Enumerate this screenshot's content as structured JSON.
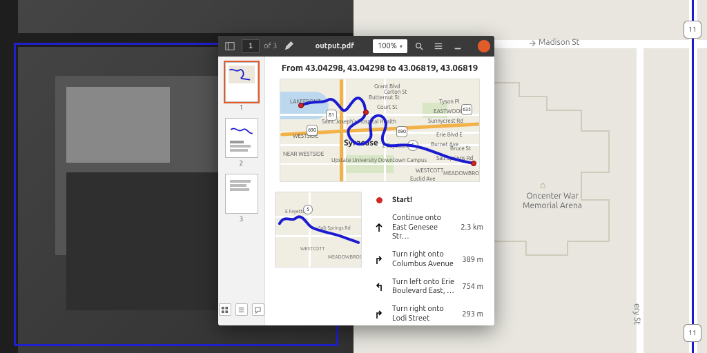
{
  "background": {
    "right_map": {
      "street_label": "Madison St",
      "arena_label": "Oncenter War Memorial Arena",
      "shield_1": "11",
      "shield_2": "11",
      "side_street": "ery St"
    }
  },
  "pdf": {
    "toolbar": {
      "page_input": "1",
      "of_text": "of 3",
      "title": "output.pdf",
      "zoom": "100%"
    },
    "thumbs": {
      "labels": [
        "1",
        "2",
        "3"
      ],
      "selected_index": 0
    },
    "doc_title": "From 43.04298, 43.04298 to 43.06819, 43.06819",
    "map_wide": {
      "city_label": "Syracuse",
      "labels": {
        "lakefront": "LAKEFRONT",
        "near_westside": "NEAR WESTSIDE",
        "westside": "WESTSIDE",
        "eastwood": "EASTWOOD",
        "westcott": "WESTCOTT",
        "meadowbrook": "MEADOWBROOK",
        "hospital": "Saint Joseph's Hospital Health",
        "upstate": "Upstate University Downtown Campus",
        "grant": "Grant Blvd",
        "butternut": "Butternut St",
        "court": "Court St",
        "erie_e": "Erie Blvd E",
        "fayette": "E Fayette St",
        "burnet": "Burnet Ave",
        "carton": "Carton St",
        "tyson": "Tyson Pl",
        "sunnycrest": "Sunnycrest Rd",
        "salt_springs": "Salt Springs Rd",
        "euclid": "Euclid Ave",
        "bruce": "Bruce St"
      },
      "shields": {
        "i81": "81",
        "i690a": "690",
        "i690b": "690",
        "rt635": "635",
        "rt5": "5"
      }
    },
    "map_small": {
      "labels": {
        "fayette": "E Fayette St",
        "salt_springs": "Salt Springs Rd",
        "westcott": "WESTCOTT",
        "meadowbrook": "MEADOWBROOK"
      },
      "shield": "5"
    },
    "directions": [
      {
        "icon": "start",
        "text": "Start!",
        "dist": ""
      },
      {
        "icon": "up",
        "text": "Continue onto East Genesee Str…",
        "dist": "2.3 km"
      },
      {
        "icon": "right",
        "text": "Turn right onto Columbus Avenue",
        "dist": "389 m"
      },
      {
        "icon": "left",
        "text": "Turn left onto Erie Boulevard East, …",
        "dist": "754 m"
      },
      {
        "icon": "right",
        "text": "Turn right onto Lodi Street",
        "dist": "293 m"
      }
    ]
  }
}
